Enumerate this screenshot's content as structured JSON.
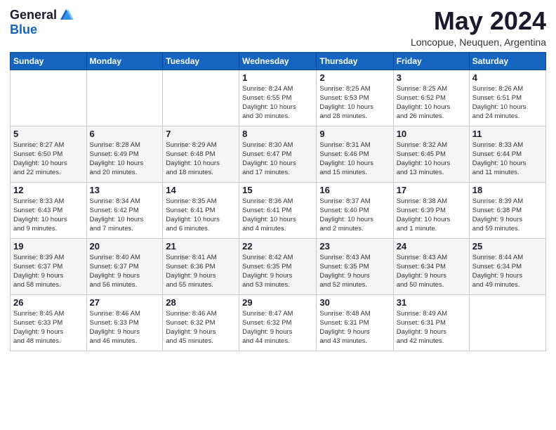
{
  "logo": {
    "general": "General",
    "blue": "Blue"
  },
  "title": "May 2024",
  "subtitle": "Loncopue, Neuquen, Argentina",
  "weekdays": [
    "Sunday",
    "Monday",
    "Tuesday",
    "Wednesday",
    "Thursday",
    "Friday",
    "Saturday"
  ],
  "weeks": [
    [
      {
        "day": "",
        "info": ""
      },
      {
        "day": "",
        "info": ""
      },
      {
        "day": "",
        "info": ""
      },
      {
        "day": "1",
        "info": "Sunrise: 8:24 AM\nSunset: 6:55 PM\nDaylight: 10 hours\nand 30 minutes."
      },
      {
        "day": "2",
        "info": "Sunrise: 8:25 AM\nSunset: 6:53 PM\nDaylight: 10 hours\nand 28 minutes."
      },
      {
        "day": "3",
        "info": "Sunrise: 8:25 AM\nSunset: 6:52 PM\nDaylight: 10 hours\nand 26 minutes."
      },
      {
        "day": "4",
        "info": "Sunrise: 8:26 AM\nSunset: 6:51 PM\nDaylight: 10 hours\nand 24 minutes."
      }
    ],
    [
      {
        "day": "5",
        "info": "Sunrise: 8:27 AM\nSunset: 6:50 PM\nDaylight: 10 hours\nand 22 minutes."
      },
      {
        "day": "6",
        "info": "Sunrise: 8:28 AM\nSunset: 6:49 PM\nDaylight: 10 hours\nand 20 minutes."
      },
      {
        "day": "7",
        "info": "Sunrise: 8:29 AM\nSunset: 6:48 PM\nDaylight: 10 hours\nand 18 minutes."
      },
      {
        "day": "8",
        "info": "Sunrise: 8:30 AM\nSunset: 6:47 PM\nDaylight: 10 hours\nand 17 minutes."
      },
      {
        "day": "9",
        "info": "Sunrise: 8:31 AM\nSunset: 6:46 PM\nDaylight: 10 hours\nand 15 minutes."
      },
      {
        "day": "10",
        "info": "Sunrise: 8:32 AM\nSunset: 6:45 PM\nDaylight: 10 hours\nand 13 minutes."
      },
      {
        "day": "11",
        "info": "Sunrise: 8:33 AM\nSunset: 6:44 PM\nDaylight: 10 hours\nand 11 minutes."
      }
    ],
    [
      {
        "day": "12",
        "info": "Sunrise: 8:33 AM\nSunset: 6:43 PM\nDaylight: 10 hours\nand 9 minutes."
      },
      {
        "day": "13",
        "info": "Sunrise: 8:34 AM\nSunset: 6:42 PM\nDaylight: 10 hours\nand 7 minutes."
      },
      {
        "day": "14",
        "info": "Sunrise: 8:35 AM\nSunset: 6:41 PM\nDaylight: 10 hours\nand 6 minutes."
      },
      {
        "day": "15",
        "info": "Sunrise: 8:36 AM\nSunset: 6:41 PM\nDaylight: 10 hours\nand 4 minutes."
      },
      {
        "day": "16",
        "info": "Sunrise: 8:37 AM\nSunset: 6:40 PM\nDaylight: 10 hours\nand 2 minutes."
      },
      {
        "day": "17",
        "info": "Sunrise: 8:38 AM\nSunset: 6:39 PM\nDaylight: 10 hours\nand 1 minute."
      },
      {
        "day": "18",
        "info": "Sunrise: 8:39 AM\nSunset: 6:38 PM\nDaylight: 9 hours\nand 59 minutes."
      }
    ],
    [
      {
        "day": "19",
        "info": "Sunrise: 8:39 AM\nSunset: 6:37 PM\nDaylight: 9 hours\nand 58 minutes."
      },
      {
        "day": "20",
        "info": "Sunrise: 8:40 AM\nSunset: 6:37 PM\nDaylight: 9 hours\nand 56 minutes."
      },
      {
        "day": "21",
        "info": "Sunrise: 8:41 AM\nSunset: 6:36 PM\nDaylight: 9 hours\nand 55 minutes."
      },
      {
        "day": "22",
        "info": "Sunrise: 8:42 AM\nSunset: 6:35 PM\nDaylight: 9 hours\nand 53 minutes."
      },
      {
        "day": "23",
        "info": "Sunrise: 8:43 AM\nSunset: 6:35 PM\nDaylight: 9 hours\nand 52 minutes."
      },
      {
        "day": "24",
        "info": "Sunrise: 8:43 AM\nSunset: 6:34 PM\nDaylight: 9 hours\nand 50 minutes."
      },
      {
        "day": "25",
        "info": "Sunrise: 8:44 AM\nSunset: 6:34 PM\nDaylight: 9 hours\nand 49 minutes."
      }
    ],
    [
      {
        "day": "26",
        "info": "Sunrise: 8:45 AM\nSunset: 6:33 PM\nDaylight: 9 hours\nand 48 minutes."
      },
      {
        "day": "27",
        "info": "Sunrise: 8:46 AM\nSunset: 6:33 PM\nDaylight: 9 hours\nand 46 minutes."
      },
      {
        "day": "28",
        "info": "Sunrise: 8:46 AM\nSunset: 6:32 PM\nDaylight: 9 hours\nand 45 minutes."
      },
      {
        "day": "29",
        "info": "Sunrise: 8:47 AM\nSunset: 6:32 PM\nDaylight: 9 hours\nand 44 minutes."
      },
      {
        "day": "30",
        "info": "Sunrise: 8:48 AM\nSunset: 6:31 PM\nDaylight: 9 hours\nand 43 minutes."
      },
      {
        "day": "31",
        "info": "Sunrise: 8:49 AM\nSunset: 6:31 PM\nDaylight: 9 hours\nand 42 minutes."
      },
      {
        "day": "",
        "info": ""
      }
    ]
  ]
}
